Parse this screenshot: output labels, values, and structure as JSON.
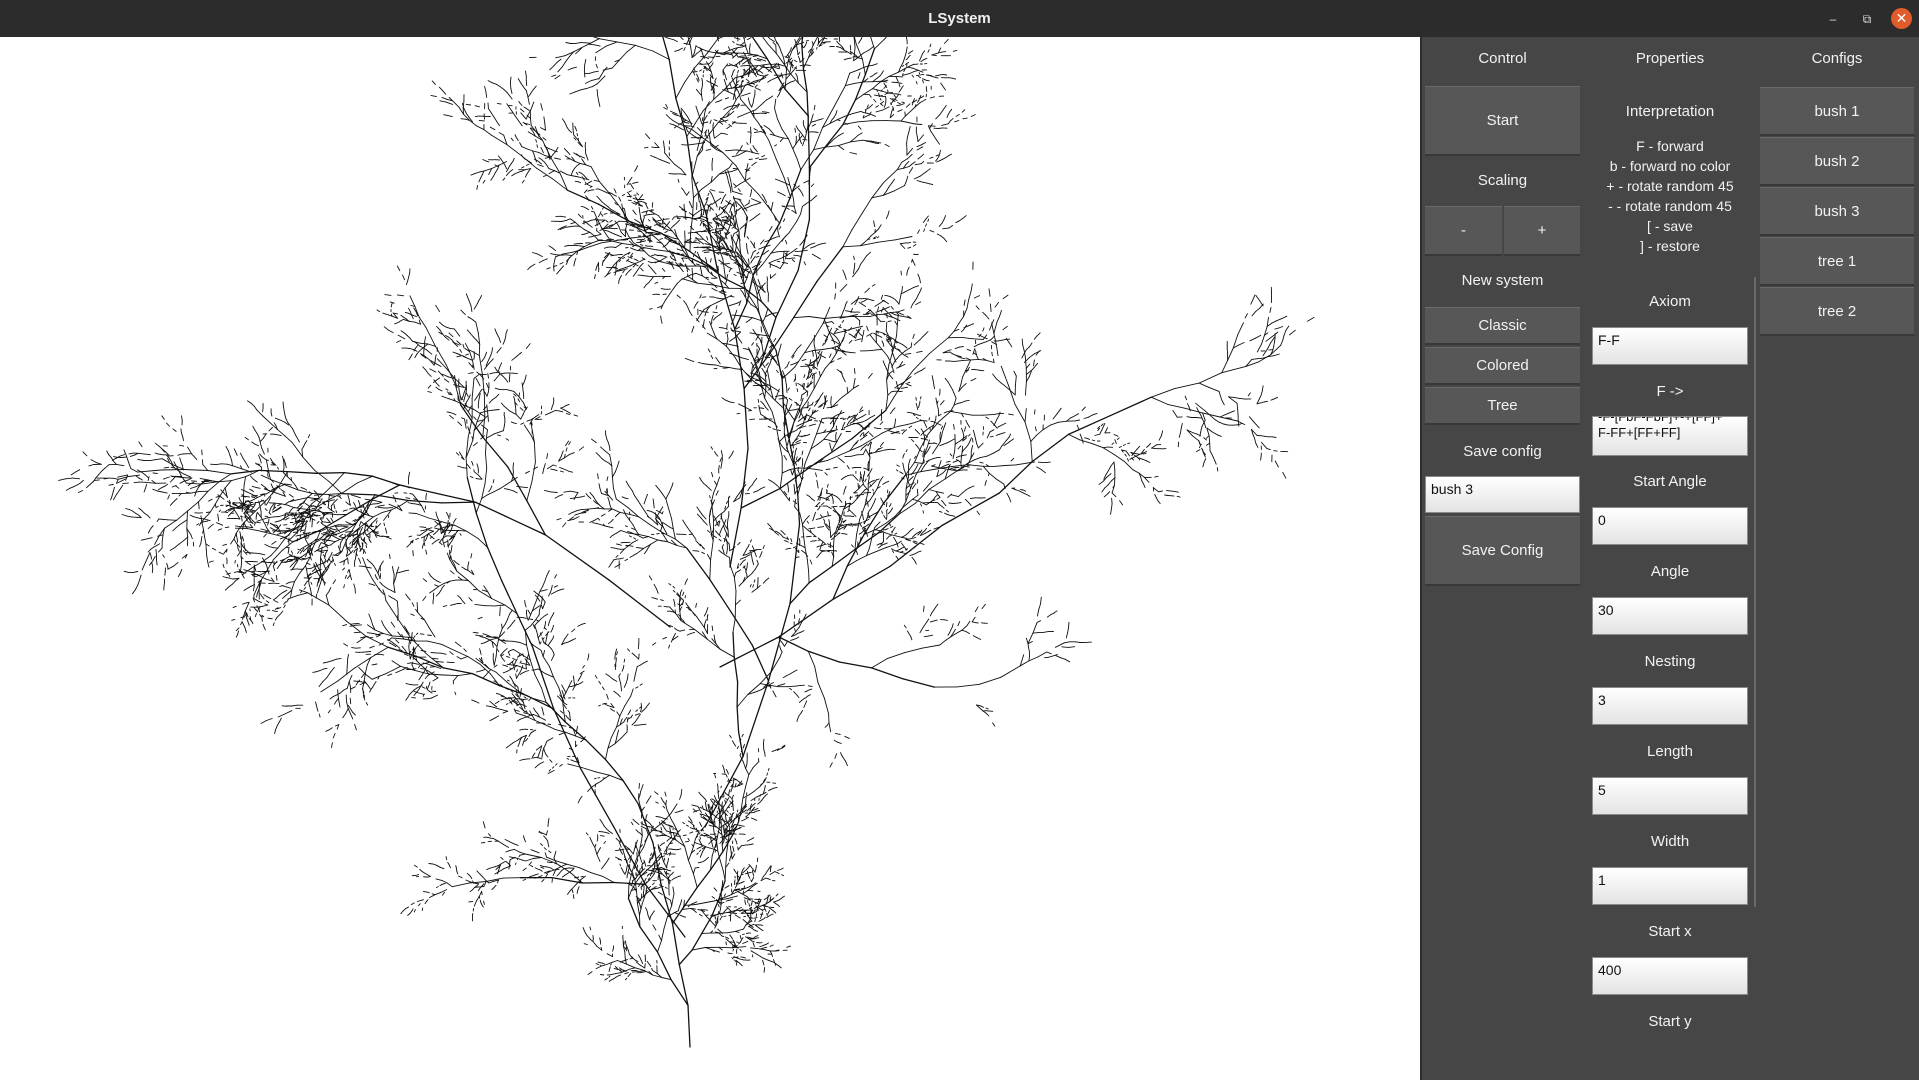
{
  "window": {
    "title": "LSystem",
    "controls": [
      "minimize-icon",
      "restore-icon",
      "close-icon"
    ]
  },
  "control": {
    "heading": "Control",
    "start_label": "Start",
    "scaling_label": "Scaling",
    "scale_minus": "-",
    "scale_plus": "+",
    "new_system_label": "New system",
    "presets": [
      "Classic",
      "Colored",
      "Tree"
    ],
    "save_config_label": "Save config",
    "config_name_value": "bush 3",
    "save_button_label": "Save Config"
  },
  "properties": {
    "heading": "Properties",
    "interpretation_title": "Interpretation",
    "interpretation_lines": [
      "F - forward",
      "b - forward no color",
      "+ - rotate random 45",
      "- - rotate random 45",
      "[ - save",
      "] - restore"
    ],
    "axiom_label": "Axiom",
    "axiom_value": "F-F",
    "rule_label": "F ->",
    "rule_line1": "-F-[FbF-FbF]+-+[FF]+",
    "rule_line2": "F-FF+[FF+FF]",
    "start_angle_label": "Start Angle",
    "start_angle_value": "0",
    "angle_label": "Angle",
    "angle_value": "30",
    "nesting_label": "Nesting",
    "nesting_value": "3",
    "length_label": "Length",
    "length_value": "5",
    "width_label": "Width",
    "width_value": "1",
    "start_x_label": "Start x",
    "start_x_value": "400",
    "start_y_label": "Start y"
  },
  "configs": {
    "heading": "Configs",
    "items": [
      "bush 1",
      "bush 2",
      "bush 3",
      "tree 1",
      "tree 2"
    ]
  }
}
